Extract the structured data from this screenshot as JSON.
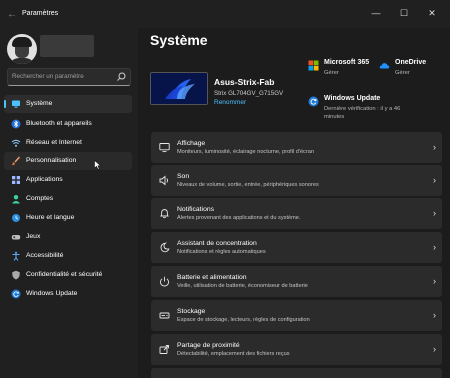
{
  "window": {
    "title": "Paramètres",
    "back_glyph": "←",
    "minimize_glyph": "—",
    "maximize_glyph": "☐",
    "close_glyph": "✕"
  },
  "search": {
    "placeholder": "Rechercher un paramètre"
  },
  "sidebar": {
    "items": [
      {
        "label": "Système",
        "icon": "monitor-icon",
        "active": true
      },
      {
        "label": "Bluetooth et appareils",
        "icon": "bluetooth-icon"
      },
      {
        "label": "Réseau et Internet",
        "icon": "wifi-icon"
      },
      {
        "label": "Personnalisation",
        "icon": "brush-icon"
      },
      {
        "label": "Applications",
        "icon": "apps-icon"
      },
      {
        "label": "Comptes",
        "icon": "person-icon"
      },
      {
        "label": "Heure et langue",
        "icon": "globe-clock-icon"
      },
      {
        "label": "Jeux",
        "icon": "gamepad-icon"
      },
      {
        "label": "Accessibilité",
        "icon": "accessibility-icon"
      },
      {
        "label": "Confidentialité et sécurité",
        "icon": "shield-icon"
      },
      {
        "label": "Windows Update",
        "icon": "update-icon"
      }
    ]
  },
  "main": {
    "title": "Système",
    "device": {
      "name": "Asus-Strix-Fab",
      "model": "Strix GL704GV_G715GV",
      "rename_label": "Renommer"
    },
    "quick_status": [
      {
        "title": "Microsoft 365",
        "desc": "Gérer",
        "icon": "microsoft-365-icon"
      },
      {
        "title": "OneDrive",
        "desc": "Gérer",
        "icon": "onedrive-icon"
      },
      {
        "title": "Windows Update",
        "desc": "Dernière vérification : il y a 46",
        "desc2": "minutes",
        "icon": "windows-update-icon"
      }
    ],
    "cards": [
      {
        "title": "Affichage",
        "desc": "Moniteurs, luminosité, éclairage nocturne, profil d'écran",
        "icon": "display-icon"
      },
      {
        "title": "Son",
        "desc": "Niveaux de volume, sortie, entrée, périphériques sonores",
        "icon": "speaker-icon"
      },
      {
        "title": "Notifications",
        "desc": "Alertes provenant des applications et du système.",
        "icon": "bell-icon"
      },
      {
        "title": "Assistant de concentration",
        "desc": "Notifications et règles automatiques",
        "icon": "moon-icon"
      },
      {
        "title": "Batterie et alimentation",
        "desc": "Veille, utilisation de batterie, économiseur de batterie",
        "icon": "power-icon"
      },
      {
        "title": "Stockage",
        "desc": "Espace de stockage, lecteurs, règles de configuration",
        "icon": "storage-icon"
      },
      {
        "title": "Partage de proximité",
        "desc": "Détectabilité, emplacement des fichiers reçus",
        "icon": "share-icon"
      }
    ]
  },
  "colors": {
    "accent": "#4cc2ff",
    "card_bg": "#2b2b2b",
    "sidebar_bg": "#202020",
    "main_bg": "#1c1c1c"
  }
}
